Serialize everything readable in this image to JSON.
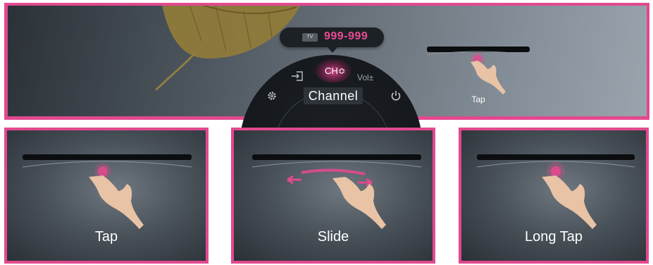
{
  "menu": {
    "tv_badge": "TV",
    "channel_number": "999-999",
    "items": {
      "channel": "CH≎",
      "volume": "Vol±"
    },
    "title": "Channel"
  },
  "top_caption": "Tap",
  "gestures": [
    {
      "label": "Tap"
    },
    {
      "label": "Slide"
    },
    {
      "label": "Long Tap"
    }
  ],
  "colors": {
    "accent": "#e2498f",
    "channel_number": "#e84d92",
    "wheel": "#15181c"
  },
  "icons": [
    "input-icon",
    "gear-icon",
    "power-icon",
    "hand-icon",
    "arrow-left-icon",
    "arrow-right-icon"
  ]
}
